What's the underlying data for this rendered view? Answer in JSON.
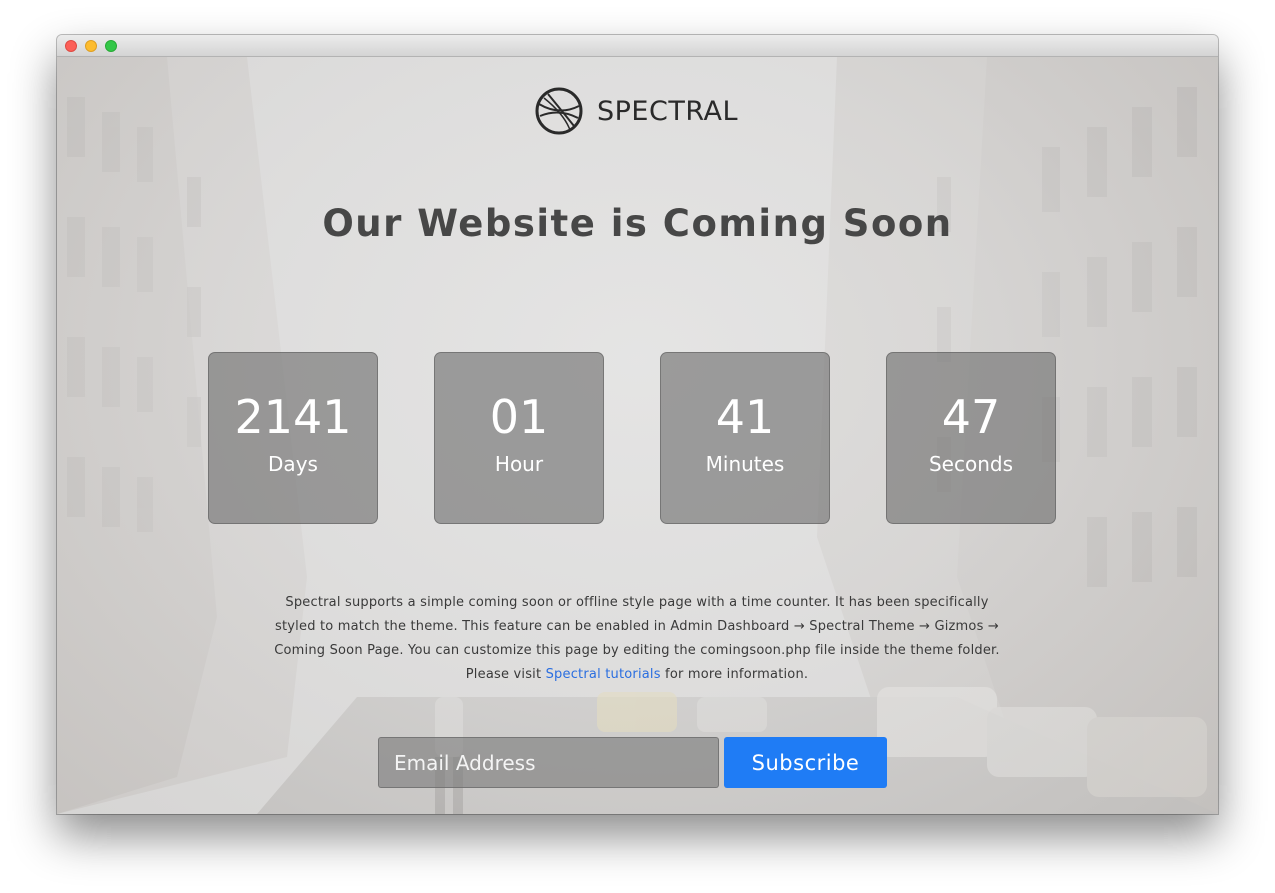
{
  "window": {
    "buttons": [
      "close",
      "minimize",
      "maximize"
    ]
  },
  "brand": {
    "name": "SPECTRAL",
    "logo_icon": "spectral-logo-icon"
  },
  "headline": "Our Website is Coming Soon",
  "countdown": [
    {
      "value": "2141",
      "unit": "Days"
    },
    {
      "value": "01",
      "unit": "Hour"
    },
    {
      "value": "41",
      "unit": "Minutes"
    },
    {
      "value": "47",
      "unit": "Seconds"
    }
  ],
  "description": {
    "line1": "Spectral supports a simple coming soon or offline style page with a time counter. It has been specifically",
    "line2": "styled to match the theme. This feature can be enabled in Admin Dashboard → Spectral Theme → Gizmos →",
    "line3": "Coming Soon Page. You can customize this page by editing the comingsoon.php file inside the theme folder.",
    "line4_prefix": "Please visit ",
    "link_text": "Spectral tutorials",
    "line4_suffix": " for more information."
  },
  "subscribe": {
    "placeholder": "Email Address",
    "button_label": "Subscribe"
  },
  "colors": {
    "accent": "#1f7cf5",
    "link": "#2a6ee0",
    "counter_bg": "#6e6e6e",
    "headline": "#474747"
  }
}
